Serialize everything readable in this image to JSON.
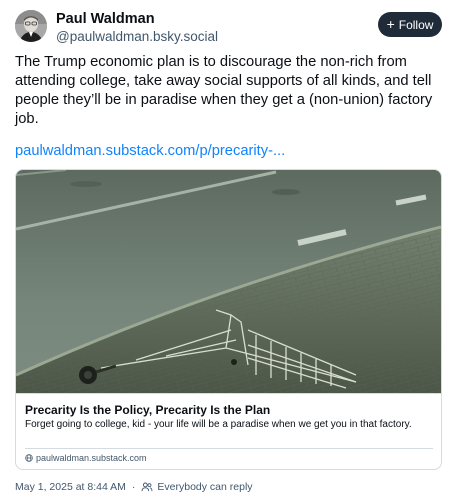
{
  "author": {
    "name": "Paul Waldman",
    "handle": "@paulwaldman.bsky.social",
    "avatar_icon": "user-avatar"
  },
  "follow_button": {
    "label": "Follow",
    "icon": "plus-icon"
  },
  "post": {
    "text": "The Trump economic plan is to discourage the non-rich from attending college, take away social supports of all kinds, and tell people they’ll be in paradise when they get a (non-union) factory job.",
    "link": "paulwaldman.substack.com/p/precarity-..."
  },
  "link_card": {
    "image_icon": "abandoned-shopping-cart-photo",
    "title": "Precarity Is the Policy, Precarity Is the Plan",
    "description": "Forget going to college, kid - your life will be a paradise when we get you in that factory.",
    "domain": "paulwaldman.substack.com",
    "domain_icon": "globe-icon"
  },
  "meta": {
    "timestamp": "May 1, 2025 at 8:44 AM",
    "separator": "·",
    "reply_setting": "Everybody can reply",
    "reply_icon": "people-icon"
  },
  "colors": {
    "link": "#1083fe",
    "follow_bg": "#1f2b38",
    "secondary_text": "#42576c",
    "border": "#d4dbe2"
  }
}
